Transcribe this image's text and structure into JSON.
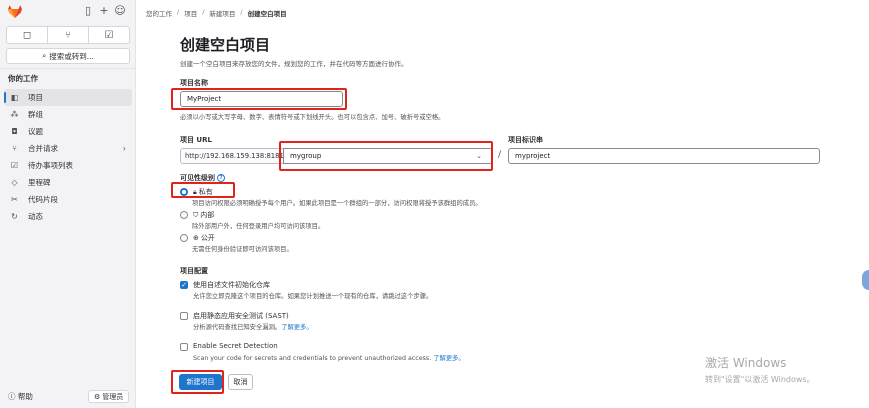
{
  "sidebar": {
    "top_icons": [
      "panel-toggle-icon",
      "plus-icon",
      "avatar-icon"
    ],
    "quick_buttons": [
      {
        "icon": "issues-icon"
      },
      {
        "icon": "merge-request-icon"
      },
      {
        "icon": "todo-icon"
      }
    ],
    "search_label": "搜索或转到...",
    "section_title": "你的工作",
    "items": [
      {
        "label": "项目",
        "icon": "project-icon",
        "active": true
      },
      {
        "label": "群组",
        "icon": "group-icon"
      },
      {
        "label": "议题",
        "icon": "issue-icon"
      },
      {
        "label": "合并请求",
        "icon": "merge-request-icon",
        "has_chevron": true
      },
      {
        "label": "待办事项列表",
        "icon": "todo-icon"
      },
      {
        "label": "里程碑",
        "icon": "milestone-icon"
      },
      {
        "label": "代码片段",
        "icon": "snippet-icon"
      },
      {
        "label": "动态",
        "icon": "activity-icon"
      }
    ],
    "help_label": "帮助",
    "admin_label": "管理员"
  },
  "breadcrumb": [
    "您的工作",
    "项目",
    "新建项目",
    "创建空白项目"
  ],
  "main": {
    "title": "创建空白项目",
    "description": "创建一个空白项目来存放您的文件，规划您的工作，并在代码等方面进行协作。",
    "project_name_label": "项目名称",
    "project_name_value": "MyProject",
    "project_name_help": "必须以小写或大写字母、数字、表情符号或下划线开头。也可以包含点、加号、破折号或空格。",
    "project_url_label": "项目 URL",
    "project_url_prefix": "http://192.168.159.138:8181/",
    "namespace_value": "mygroup",
    "slash": "/",
    "project_slug_label": "项目标识串",
    "project_slug_value": "myproject",
    "visibility_label": "可见性级别",
    "visibility_options": [
      {
        "label": "私有",
        "icon": "lock-icon",
        "checked": true,
        "desc": "项目访问权限必须明确授予每个用户。如果此项目是一个群组的一部分，访问权限将授予该群组的成员。"
      },
      {
        "label": "内部",
        "icon": "shield-icon",
        "checked": false,
        "desc": "除外部用户外，任何登录用户均可访问该项目。"
      },
      {
        "label": "公开",
        "icon": "globe-icon",
        "checked": false,
        "desc": "无需任何身份验证即可访问该项目。"
      }
    ],
    "config_label": "项目配置",
    "config_options": [
      {
        "label": "使用自述文件初始化仓库",
        "checked": true,
        "desc": "允许您立即克隆这个项目的仓库。如果您计划推送一个现有的仓库，请跳过这个步骤。",
        "link": ""
      },
      {
        "label": "启用静态应用安全测试 (SAST)",
        "checked": false,
        "desc": "分析源代码查找已知安全漏洞。",
        "link": "了解更多。"
      },
      {
        "label": "Enable Secret Detection",
        "checked": false,
        "desc": "Scan your code for secrets and credentials to prevent unauthorized access.",
        "link": "了解更多。"
      }
    ],
    "create_button": "新建项目",
    "cancel_button": "取消"
  },
  "watermark": {
    "line1": "激活 Windows",
    "line2": "转到\"设置\"以激活 Windows。"
  },
  "colors": {
    "accent": "#1f75cb",
    "annotation_red": "#e0241b",
    "sidebar_bg": "#f3f3f5"
  }
}
